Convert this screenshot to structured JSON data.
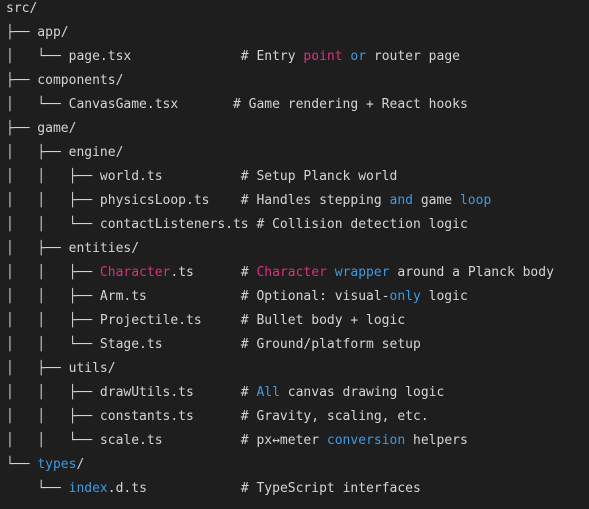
{
  "lines": [
    {
      "segs": [
        {
          "t": "src/",
          "c": "p"
        }
      ]
    },
    {
      "segs": [
        {
          "t": "├── app/",
          "c": "p"
        }
      ]
    },
    {
      "segs": [
        {
          "t": "│   └── page.tsx              # Entry ",
          "c": "p"
        },
        {
          "t": "point",
          "c": "pink"
        },
        {
          "t": " ",
          "c": "p"
        },
        {
          "t": "or",
          "c": "blue"
        },
        {
          "t": " router page",
          "c": "p"
        }
      ]
    },
    {
      "segs": [
        {
          "t": "├── components/",
          "c": "p"
        }
      ]
    },
    {
      "segs": [
        {
          "t": "│   └── CanvasGame.tsx       # Game rendering + React hooks",
          "c": "p"
        }
      ]
    },
    {
      "segs": [
        {
          "t": "├── game/",
          "c": "p"
        }
      ]
    },
    {
      "segs": [
        {
          "t": "│   ├── engine/",
          "c": "p"
        }
      ]
    },
    {
      "segs": [
        {
          "t": "│   │   ├── world.ts          # Setup Planck world",
          "c": "p"
        }
      ]
    },
    {
      "segs": [
        {
          "t": "│   │   ├── physicsLoop.ts    # Handles stepping ",
          "c": "p"
        },
        {
          "t": "and",
          "c": "blue"
        },
        {
          "t": " game ",
          "c": "p"
        },
        {
          "t": "loop",
          "c": "blue"
        }
      ]
    },
    {
      "segs": [
        {
          "t": "│   │   └── contactListeners.ts # Collision detection logic",
          "c": "p"
        }
      ]
    },
    {
      "segs": [
        {
          "t": "│   ├── entities/",
          "c": "p"
        }
      ]
    },
    {
      "segs": [
        {
          "t": "│   │   ├── ",
          "c": "p"
        },
        {
          "t": "Character",
          "c": "pink"
        },
        {
          "t": ".ts      # ",
          "c": "p"
        },
        {
          "t": "Character",
          "c": "pink"
        },
        {
          "t": " ",
          "c": "p"
        },
        {
          "t": "wrapper",
          "c": "blue"
        },
        {
          "t": " around a Planck body",
          "c": "p"
        }
      ]
    },
    {
      "segs": [
        {
          "t": "│   │   ├── Arm.ts            # Optional: visual-",
          "c": "p"
        },
        {
          "t": "only",
          "c": "blue"
        },
        {
          "t": " logic",
          "c": "p"
        }
      ]
    },
    {
      "segs": [
        {
          "t": "│   │   ├── Projectile.ts     # Bullet body + logic",
          "c": "p"
        }
      ]
    },
    {
      "segs": [
        {
          "t": "│   │   └── Stage.ts          # Ground/platform setup",
          "c": "p"
        }
      ]
    },
    {
      "segs": [
        {
          "t": "│   ├── utils/",
          "c": "p"
        }
      ]
    },
    {
      "segs": [
        {
          "t": "│   │   ├── drawUtils.ts      # ",
          "c": "p"
        },
        {
          "t": "All",
          "c": "blue"
        },
        {
          "t": " canvas drawing logic",
          "c": "p"
        }
      ]
    },
    {
      "segs": [
        {
          "t": "│   │   ├── constants.ts      # Gravity, scaling, etc.",
          "c": "p"
        }
      ]
    },
    {
      "segs": [
        {
          "t": "│   │   └── scale.ts          # px↔meter ",
          "c": "p"
        },
        {
          "t": "conversion",
          "c": "blue"
        },
        {
          "t": " helpers",
          "c": "p"
        }
      ]
    },
    {
      "segs": [
        {
          "t": "└── ",
          "c": "p"
        },
        {
          "t": "types",
          "c": "blue"
        },
        {
          "t": "/",
          "c": "p"
        }
      ]
    },
    {
      "segs": [
        {
          "t": "    └── ",
          "c": "p"
        },
        {
          "t": "index",
          "c": "blue"
        },
        {
          "t": ".d.ts            # TypeScript interfaces",
          "c": "p"
        }
      ]
    }
  ],
  "colors": {
    "background": "#1e1e1e",
    "text": "#d4d4d4",
    "keyword_pink": "#d8317c",
    "keyword_blue": "#3c9be0"
  }
}
